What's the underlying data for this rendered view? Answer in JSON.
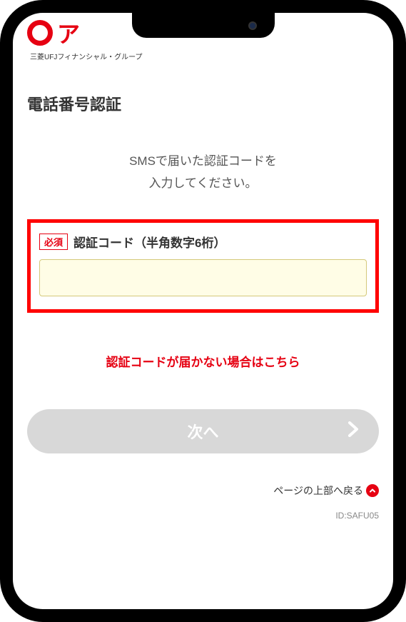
{
  "header": {
    "logo_text": "ア",
    "subtitle": "三菱UFJフィナンシャル・グループ"
  },
  "page": {
    "title": "電話番号認証",
    "instruction_line1": "SMSで届いた認証コードを",
    "instruction_line2": "入力してください。"
  },
  "form": {
    "required_badge": "必須",
    "field_label": "認証コード（半角数字6桁）",
    "code_value": ""
  },
  "links": {
    "help_link": "認証コードが届かない場合はこちら",
    "back_to_top": "ページの上部へ戻る"
  },
  "buttons": {
    "next": "次へ"
  },
  "footer": {
    "page_id": "ID:SAFU05"
  }
}
